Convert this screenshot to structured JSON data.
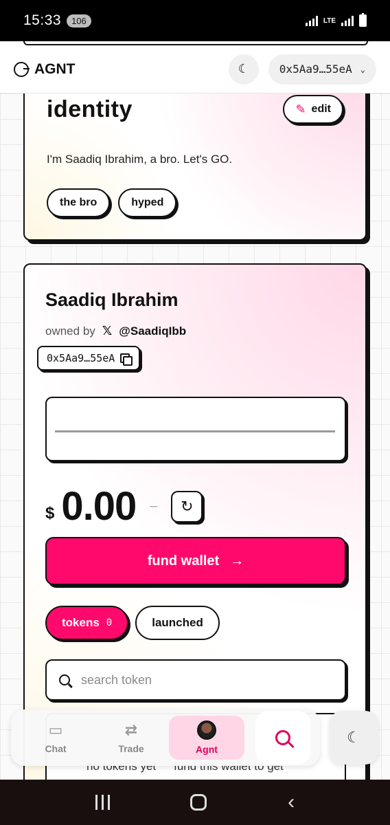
{
  "status_bar": {
    "time": "15:33",
    "notification_count": "106",
    "network": "LTE"
  },
  "header": {
    "app_name": "AGNT",
    "wallet_address": "0x5Aa9…55eA"
  },
  "identity": {
    "title": "identity",
    "edit_label": "edit",
    "bio": "I'm Saadiq Ibrahim, a bro. Let's GO.",
    "tags": [
      "the bro",
      "hyped"
    ]
  },
  "profile": {
    "name": "Saadiq Ibrahim",
    "owned_by_label": "owned by",
    "x_handle": "@SaadiqIbb",
    "address": "0x5Aa9…55eA",
    "currency_symbol": "$",
    "balance": "0.00",
    "change": "–",
    "fund_label": "fund wallet",
    "tabs": [
      {
        "label": "tokens",
        "count": "0"
      },
      {
        "label": "launched"
      }
    ],
    "search_placeholder": "search token",
    "empty_left": "no tokens yet",
    "empty_right": "fund this wallet to get"
  },
  "bottom_nav": {
    "items": [
      {
        "label": "Chat",
        "icon": "chat-icon"
      },
      {
        "label": "Trade",
        "icon": "trade-arrows-icon"
      },
      {
        "label": "Agnt",
        "icon": "avatar"
      }
    ]
  },
  "colors": {
    "accent": "#ff0a6c",
    "active_tab_bg": "#ffd6e6"
  }
}
